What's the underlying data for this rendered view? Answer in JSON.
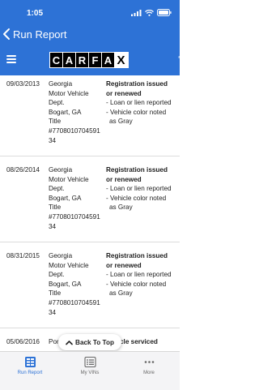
{
  "status_bar": {
    "time": "1:05"
  },
  "nav": {
    "back_label": "Run Report"
  },
  "brand": {
    "letters": [
      "C",
      "A",
      "R",
      "F",
      "A",
      "X"
    ],
    "trademark": "®"
  },
  "records": [
    {
      "date": "09/03/2013",
      "source": [
        "Georgia",
        "Motor Vehicle",
        "Dept.",
        "Bogart, GA",
        "Title",
        "#7708010704591",
        "34"
      ],
      "heading": [
        "Registration issued",
        "or renewed"
      ],
      "items": [
        [
          "- Loan or lien reported"
        ],
        [
          "- Vehicle color noted",
          "as Gray"
        ]
      ]
    },
    {
      "date": "08/26/2014",
      "source": [
        "Georgia",
        "Motor Vehicle",
        "Dept.",
        "Bogart, GA",
        "Title",
        "#7708010704591",
        "34"
      ],
      "heading": [
        "Registration issued",
        "or renewed"
      ],
      "items": [
        [
          "- Loan or lien reported"
        ],
        [
          "- Vehicle color noted",
          "as Gray"
        ]
      ]
    },
    {
      "date": "08/31/2015",
      "source": [
        "Georgia",
        "Motor Vehicle",
        "Dept.",
        "Bogart, GA",
        "Title",
        "#7708010704591",
        "34"
      ],
      "heading": [
        "Registration issued",
        "or renewed"
      ],
      "items": [
        [
          "- Loan or lien reported"
        ],
        [
          "- Vehicle color noted",
          "as Gray"
        ]
      ]
    },
    {
      "date": "05/06/2016",
      "source": [
        "Port"
      ],
      "heading": [
        "cle serviced"
      ],
      "items": []
    }
  ],
  "back_to_top": {
    "label": "Back To Top"
  },
  "tabs": [
    {
      "label": "Run Report",
      "icon": "run-report-icon",
      "active": true
    },
    {
      "label": "My VINs",
      "icon": "list-icon",
      "active": false
    },
    {
      "label": "More",
      "icon": "more-dots-icon",
      "active": false
    }
  ],
  "colors": {
    "primary": "#2d72d6",
    "tab_inactive": "#666666",
    "separator": "#dcdcdc"
  }
}
